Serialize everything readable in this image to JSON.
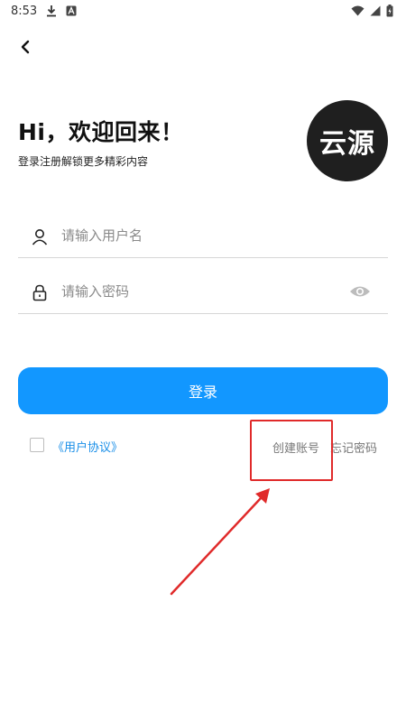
{
  "status_bar": {
    "time": "8:53",
    "icons": [
      "download-icon",
      "a-badge-icon",
      "wifi-icon",
      "signal-icon",
      "battery-icon"
    ]
  },
  "header": {
    "back_icon": "chevron-left-icon"
  },
  "welcome": {
    "title": "Hi，欢迎回来！",
    "subtitle": "登录注册解锁更多精彩内容"
  },
  "logo": {
    "text": "云源"
  },
  "form": {
    "username": {
      "placeholder": "请输入用户名",
      "value": "",
      "icon": "user-icon"
    },
    "password": {
      "placeholder": "请输入密码",
      "value": "",
      "icon": "lock-icon",
      "toggle_icon": "eye-icon"
    },
    "login_label": "登录",
    "agreement_label": "《用户协议》",
    "agreement_checked": false,
    "create_account_label": "创建账号",
    "forgot_password_label": "忘记密码"
  },
  "annotation": {
    "color": "#e02a2a"
  },
  "colors": {
    "accent": "#1297ff",
    "link": "#1a8fe8",
    "logo_bg": "#1f1f1f"
  }
}
